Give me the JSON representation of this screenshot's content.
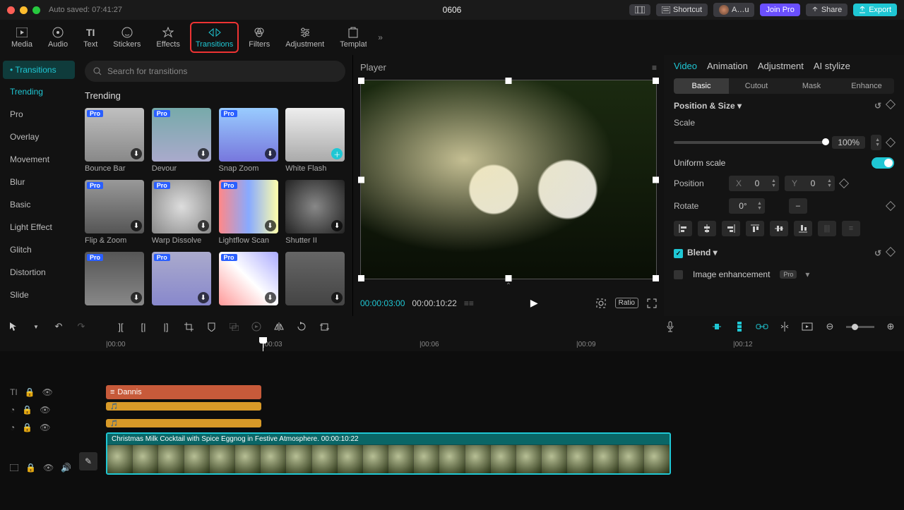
{
  "titlebar": {
    "autosave": "Auto saved: 07:41:27",
    "filename": "0606",
    "shortcut": "Shortcut",
    "user": "A…u",
    "join": "Join Pro",
    "share": "Share",
    "export": "Export"
  },
  "toptabs": {
    "items": [
      "Media",
      "Audio",
      "Text",
      "Stickers",
      "Effects",
      "Transitions",
      "Filters",
      "Adjustment",
      "Templates"
    ],
    "active": "Transitions"
  },
  "left": {
    "pill": "Transitions",
    "categories": [
      "Trending",
      "Pro",
      "Overlay",
      "Movement",
      "Blur",
      "Basic",
      "Light Effect",
      "Glitch",
      "Distortion",
      "Slide"
    ],
    "active_cat": "Trending",
    "search_ph": "Search for transitions",
    "heading": "Trending",
    "items": [
      {
        "label": "Bounce Bar",
        "pro": true,
        "btn": "dl"
      },
      {
        "label": "Devour",
        "pro": true,
        "btn": "dl"
      },
      {
        "label": "Snap Zoom",
        "pro": true,
        "btn": "dl"
      },
      {
        "label": "White Flash",
        "pro": false,
        "btn": "add"
      },
      {
        "label": "Flip & Zoom",
        "pro": true,
        "btn": "dl"
      },
      {
        "label": "Warp Dissolve",
        "pro": true,
        "btn": "dl"
      },
      {
        "label": "Lightflow Scan",
        "pro": true,
        "btn": "dl"
      },
      {
        "label": "Shutter II",
        "pro": false,
        "btn": "dl"
      },
      {
        "label": "",
        "pro": true,
        "btn": "dl"
      },
      {
        "label": "",
        "pro": true,
        "btn": "dl"
      },
      {
        "label": "",
        "pro": true,
        "btn": "dl"
      },
      {
        "label": "",
        "pro": false,
        "btn": "dl"
      }
    ]
  },
  "player": {
    "title": "Player",
    "tc_cur": "00:00:03:00",
    "tc_dur": "00:00:10:22",
    "ratio": "Ratio"
  },
  "inspector": {
    "tabs": [
      "Video",
      "Animation",
      "Adjustment",
      "AI stylize"
    ],
    "active_tab": "Video",
    "subtabs": [
      "Basic",
      "Cutout",
      "Mask",
      "Enhance"
    ],
    "active_sub": "Basic",
    "pos_size": "Position & Size",
    "scale": "Scale",
    "scale_val": "100%",
    "uniform": "Uniform scale",
    "position": "Position",
    "px": "0",
    "py": "0",
    "rotate": "Rotate",
    "rotate_val": "0°",
    "blend": "Blend",
    "img_enh": "Image enhancement",
    "pro_chip": "Pro"
  },
  "timeline": {
    "ticks": [
      "|00:00",
      "|00:03",
      "|00:06",
      "|00:09",
      "|00:12"
    ],
    "text_track": "Dannis",
    "video_title": "Christmas Milk Cocktail with Spice Eggnog in Festive Atmosphere.  00:00:10:22"
  }
}
